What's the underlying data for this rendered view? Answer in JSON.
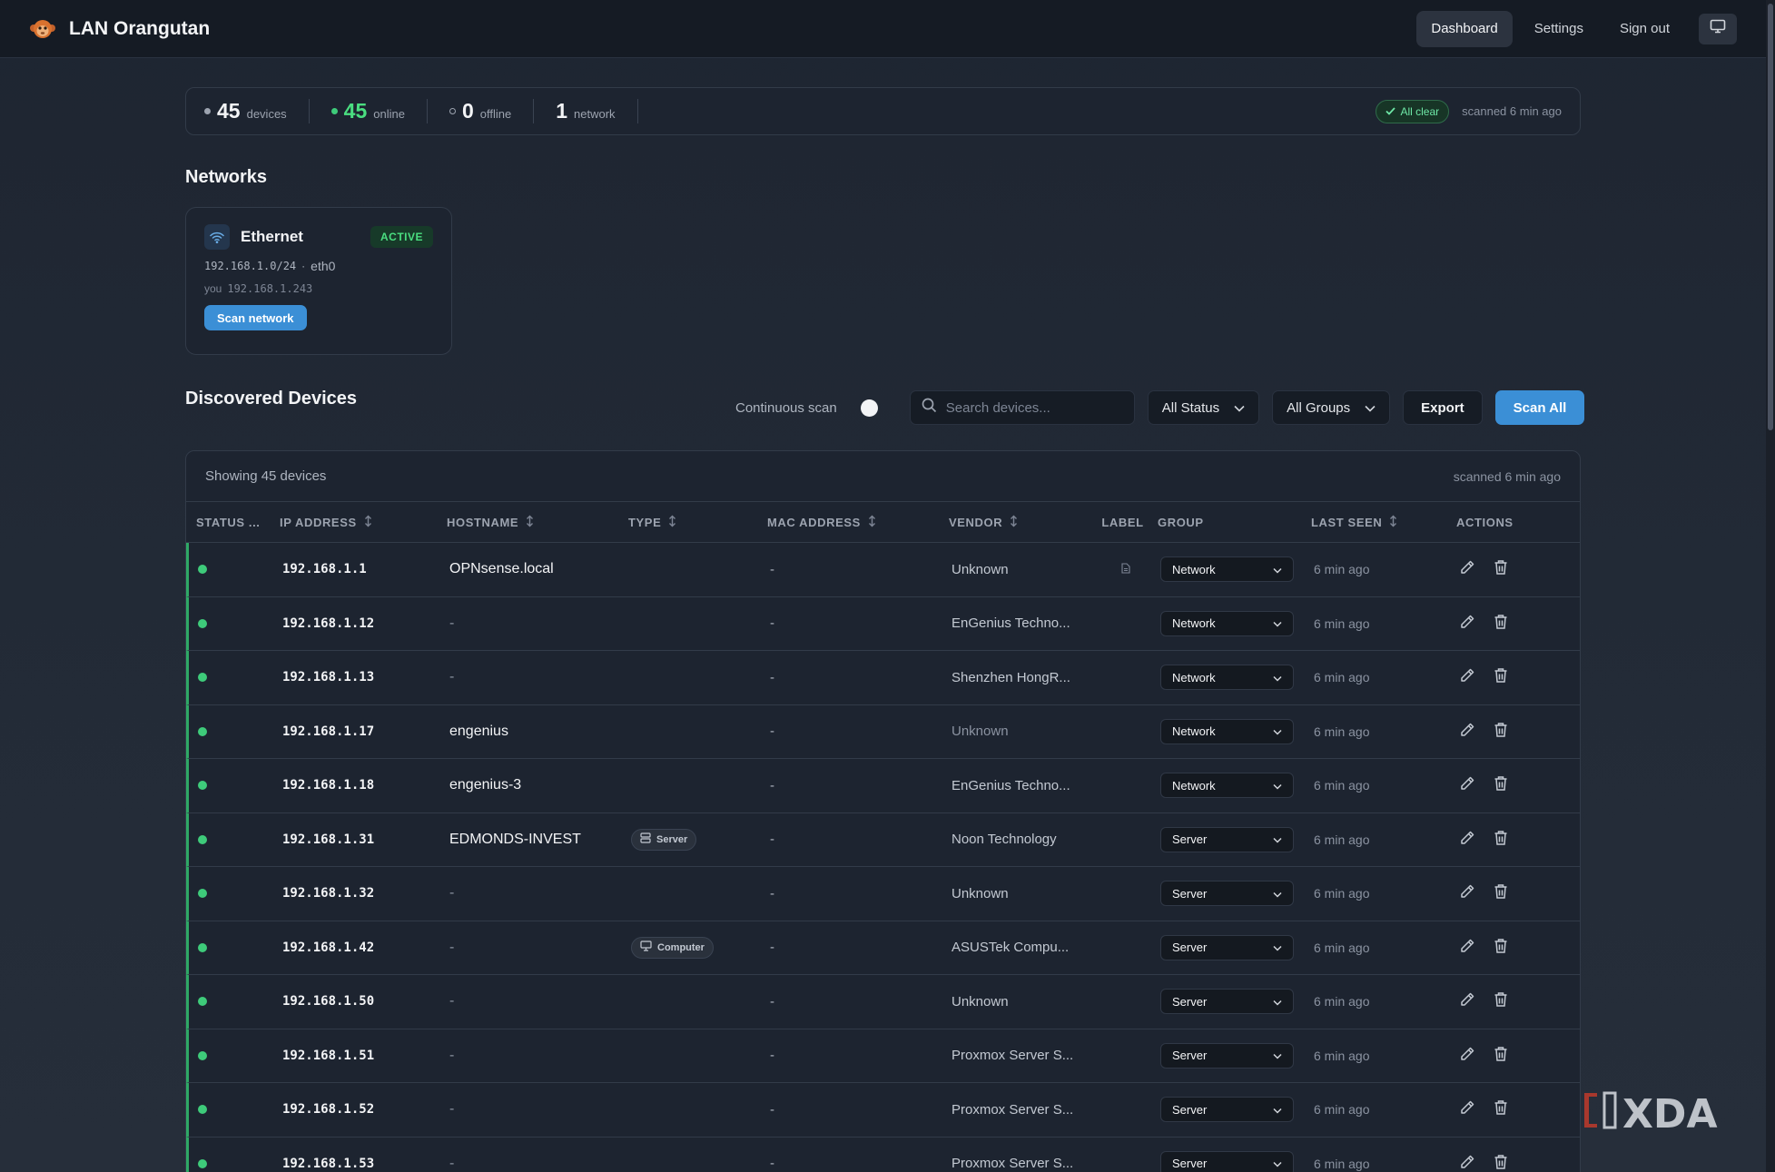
{
  "header": {
    "brand": "LAN Orangutan",
    "nav": [
      "Dashboard",
      "Settings",
      "Sign out"
    ],
    "active_nav": "Dashboard",
    "display_icon": "monitor-icon"
  },
  "stats": {
    "devices_count": "45",
    "devices_label": "devices",
    "online_count": "45",
    "online_label": "online",
    "offline_count": "0",
    "offline_label": "offline",
    "networks_count": "1",
    "networks_label": "network",
    "status_badge": "All clear",
    "scanned": "scanned 6 min ago"
  },
  "networks": {
    "title": "Networks",
    "card": {
      "name": "Ethernet",
      "status": "ACTIVE",
      "cidr": "192.168.1.0/24",
      "separator": "·",
      "interface": "eth0",
      "you_label": "you",
      "you_ip": "192.168.1.243",
      "scan_button": "Scan network"
    }
  },
  "devices": {
    "title": "Discovered Devices",
    "continuous_scan_label": "Continuous scan",
    "search_placeholder": "Search devices...",
    "status_filter": "All Status",
    "group_filter": "All Groups",
    "export_button": "Export",
    "scan_all_button": "Scan All",
    "showing": "Showing 45 devices",
    "scanned": "scanned 6 min ago",
    "columns": [
      "STATUS ...",
      "IP ADDRESS",
      "HOSTNAME",
      "TYPE",
      "MAC ADDRESS",
      "VENDOR",
      "LABEL",
      "GROUP",
      "LAST SEEN",
      "ACTIONS"
    ],
    "rows": [
      {
        "ip": "192.168.1.1",
        "hostname": "OPNsense.local",
        "type": "",
        "mac": "-",
        "vendor": "Unknown",
        "group": "Network",
        "last_seen": "6 min ago"
      },
      {
        "ip": "192.168.1.12",
        "hostname": "-",
        "type": "",
        "mac": "-",
        "vendor": "EnGenius Techno...",
        "group": "Network",
        "last_seen": "6 min ago"
      },
      {
        "ip": "192.168.1.13",
        "hostname": "-",
        "type": "",
        "mac": "-",
        "vendor": "Shenzhen HongR...",
        "group": "Network",
        "last_seen": "6 min ago"
      },
      {
        "ip": "192.168.1.17",
        "hostname": "engenius",
        "type": "",
        "mac": "-",
        "vendor": "Unknown",
        "group": "Network",
        "last_seen": "6 min ago"
      },
      {
        "ip": "192.168.1.18",
        "hostname": "engenius-3",
        "type": "",
        "mac": "-",
        "vendor": "EnGenius Techno...",
        "group": "Network",
        "last_seen": "6 min ago"
      },
      {
        "ip": "192.168.1.31",
        "hostname": "EDMONDS-INVEST",
        "type": "Server",
        "mac": "-",
        "vendor": "Noon Technology",
        "group": "Server",
        "last_seen": "6 min ago"
      },
      {
        "ip": "192.168.1.32",
        "hostname": "-",
        "type": "",
        "mac": "-",
        "vendor": "Unknown",
        "group": "Server",
        "last_seen": "6 min ago"
      },
      {
        "ip": "192.168.1.42",
        "hostname": "-",
        "type": "Computer",
        "mac": "-",
        "vendor": "ASUSTek Compu...",
        "group": "Server",
        "last_seen": "6 min ago"
      },
      {
        "ip": "192.168.1.50",
        "hostname": "-",
        "type": "",
        "mac": "-",
        "vendor": "Unknown",
        "group": "Server",
        "last_seen": "6 min ago"
      },
      {
        "ip": "192.168.1.51",
        "hostname": "-",
        "type": "",
        "mac": "-",
        "vendor": "Proxmox Server S...",
        "group": "Server",
        "last_seen": "6 min ago"
      },
      {
        "ip": "192.168.1.52",
        "hostname": "-",
        "type": "",
        "mac": "-",
        "vendor": "Proxmox Server S...",
        "group": "Server",
        "last_seen": "6 min ago"
      },
      {
        "ip": "192.168.1.53",
        "hostname": "-",
        "type": "",
        "mac": "-",
        "vendor": "Proxmox Server S...",
        "group": "Server",
        "last_seen": "6 min ago"
      }
    ]
  },
  "colors": {
    "accent": "#3b8fd6",
    "online": "#3ecb7a",
    "background": "#1e2531"
  },
  "watermark": "XDA"
}
